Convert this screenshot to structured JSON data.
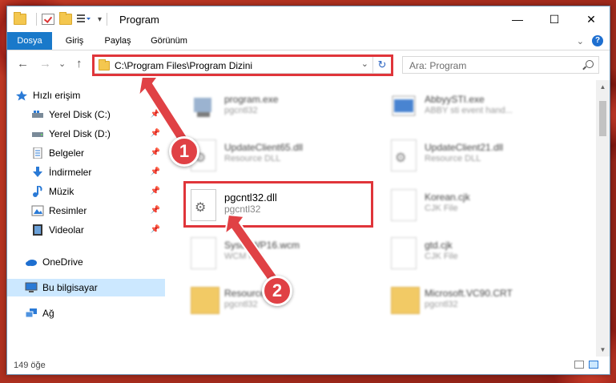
{
  "window": {
    "title": "Program",
    "controls": {
      "minimize": "—",
      "maximize": "☐",
      "close": "✕"
    }
  },
  "ribbon": {
    "tabs": [
      {
        "label": "Dosya",
        "active": true
      },
      {
        "label": "Giriş",
        "active": false
      },
      {
        "label": "Paylaş",
        "active": false
      },
      {
        "label": "Görünüm",
        "active": false
      }
    ],
    "expand_icon": "chevron-down-icon",
    "help": "?"
  },
  "nav": {
    "back": "←",
    "forward": "→",
    "recent": "⌄",
    "up": "↑",
    "address": "C:\\Program Files\\Program Dizini",
    "dropdown": "⌄",
    "refresh": "↻",
    "search_placeholder": "Ara: Program"
  },
  "sidebar": {
    "items": [
      {
        "label": "Hızlı erişim",
        "icon": "star-icon",
        "pinned": false
      },
      {
        "label": "Yerel Disk (C:)",
        "icon": "drive-icon",
        "pinned": true
      },
      {
        "label": "Yerel Disk (D:)",
        "icon": "drive-icon",
        "pinned": true
      },
      {
        "label": "Belgeler",
        "icon": "document-icon",
        "pinned": true
      },
      {
        "label": "İndirmeler",
        "icon": "download-icon",
        "pinned": true
      },
      {
        "label": "Müzik",
        "icon": "music-icon",
        "pinned": true
      },
      {
        "label": "Resimler",
        "icon": "picture-icon",
        "pinned": true
      },
      {
        "label": "Videolar",
        "icon": "film-icon",
        "pinned": true
      },
      {
        "label": "OneDrive",
        "icon": "cloud-icon",
        "pinned": false
      },
      {
        "label": "Bu bilgisayar",
        "icon": "computer-icon",
        "pinned": false,
        "selected": true
      },
      {
        "label": "Ağ",
        "icon": "network-icon",
        "pinned": false
      }
    ]
  },
  "files": [
    {
      "name": "program.exe",
      "type": "pgcntl32",
      "icon": "exe-icon"
    },
    {
      "name": "AbbyySTI.exe",
      "type": "ABBY sti event hand...",
      "icon": "exe-icon"
    },
    {
      "name": "UpdateClient65.dll",
      "type": "Resource DLL",
      "icon": "dll-icon"
    },
    {
      "name": "UpdateClient21.dll",
      "type": "Resource DLL",
      "icon": "dll-icon"
    },
    {
      "name": "pgcntl32.dll",
      "type": "pgcntl32",
      "icon": "dll-icon",
      "highlighted": true
    },
    {
      "name": "Korean.cjk",
      "type": "CJK File",
      "icon": "file-icon"
    },
    {
      "name": "SysdoWP16.wcm",
      "type": "WCM File",
      "icon": "file-icon"
    },
    {
      "name": "gtd.cjk",
      "type": "CJK File",
      "icon": "file-icon"
    },
    {
      "name": "Resource",
      "type": "pgcntl32",
      "icon": "folder-icon"
    },
    {
      "name": "Microsoft.VC90.CRT",
      "type": "pgcntl32",
      "icon": "folder-icon"
    }
  ],
  "status": {
    "count": "149 öğe"
  },
  "annotations": {
    "step1": "1",
    "step2": "2",
    "color": "#e04145"
  }
}
